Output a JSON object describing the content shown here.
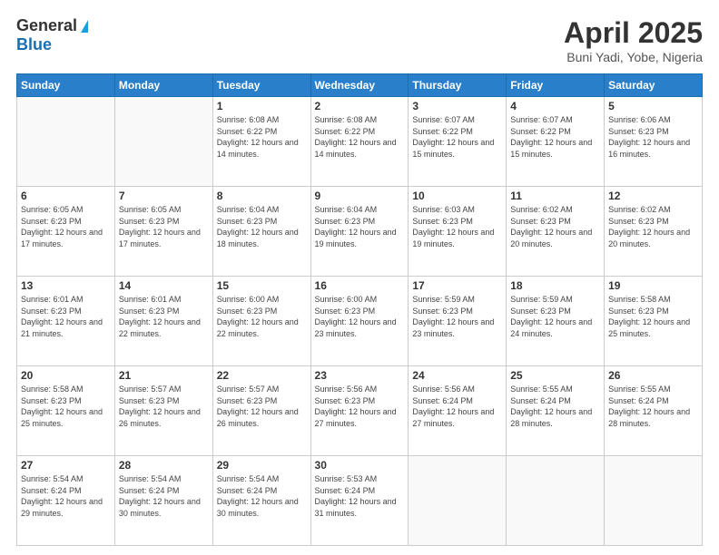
{
  "logo": {
    "general": "General",
    "blue": "Blue"
  },
  "title": "April 2025",
  "location": "Buni Yadi, Yobe, Nigeria",
  "days_of_week": [
    "Sunday",
    "Monday",
    "Tuesday",
    "Wednesday",
    "Thursday",
    "Friday",
    "Saturday"
  ],
  "weeks": [
    [
      {
        "num": "",
        "info": ""
      },
      {
        "num": "",
        "info": ""
      },
      {
        "num": "1",
        "info": "Sunrise: 6:08 AM\nSunset: 6:22 PM\nDaylight: 12 hours and 14 minutes."
      },
      {
        "num": "2",
        "info": "Sunrise: 6:08 AM\nSunset: 6:22 PM\nDaylight: 12 hours and 14 minutes."
      },
      {
        "num": "3",
        "info": "Sunrise: 6:07 AM\nSunset: 6:22 PM\nDaylight: 12 hours and 15 minutes."
      },
      {
        "num": "4",
        "info": "Sunrise: 6:07 AM\nSunset: 6:22 PM\nDaylight: 12 hours and 15 minutes."
      },
      {
        "num": "5",
        "info": "Sunrise: 6:06 AM\nSunset: 6:23 PM\nDaylight: 12 hours and 16 minutes."
      }
    ],
    [
      {
        "num": "6",
        "info": "Sunrise: 6:05 AM\nSunset: 6:23 PM\nDaylight: 12 hours and 17 minutes."
      },
      {
        "num": "7",
        "info": "Sunrise: 6:05 AM\nSunset: 6:23 PM\nDaylight: 12 hours and 17 minutes."
      },
      {
        "num": "8",
        "info": "Sunrise: 6:04 AM\nSunset: 6:23 PM\nDaylight: 12 hours and 18 minutes."
      },
      {
        "num": "9",
        "info": "Sunrise: 6:04 AM\nSunset: 6:23 PM\nDaylight: 12 hours and 19 minutes."
      },
      {
        "num": "10",
        "info": "Sunrise: 6:03 AM\nSunset: 6:23 PM\nDaylight: 12 hours and 19 minutes."
      },
      {
        "num": "11",
        "info": "Sunrise: 6:02 AM\nSunset: 6:23 PM\nDaylight: 12 hours and 20 minutes."
      },
      {
        "num": "12",
        "info": "Sunrise: 6:02 AM\nSunset: 6:23 PM\nDaylight: 12 hours and 20 minutes."
      }
    ],
    [
      {
        "num": "13",
        "info": "Sunrise: 6:01 AM\nSunset: 6:23 PM\nDaylight: 12 hours and 21 minutes."
      },
      {
        "num": "14",
        "info": "Sunrise: 6:01 AM\nSunset: 6:23 PM\nDaylight: 12 hours and 22 minutes."
      },
      {
        "num": "15",
        "info": "Sunrise: 6:00 AM\nSunset: 6:23 PM\nDaylight: 12 hours and 22 minutes."
      },
      {
        "num": "16",
        "info": "Sunrise: 6:00 AM\nSunset: 6:23 PM\nDaylight: 12 hours and 23 minutes."
      },
      {
        "num": "17",
        "info": "Sunrise: 5:59 AM\nSunset: 6:23 PM\nDaylight: 12 hours and 23 minutes."
      },
      {
        "num": "18",
        "info": "Sunrise: 5:59 AM\nSunset: 6:23 PM\nDaylight: 12 hours and 24 minutes."
      },
      {
        "num": "19",
        "info": "Sunrise: 5:58 AM\nSunset: 6:23 PM\nDaylight: 12 hours and 25 minutes."
      }
    ],
    [
      {
        "num": "20",
        "info": "Sunrise: 5:58 AM\nSunset: 6:23 PM\nDaylight: 12 hours and 25 minutes."
      },
      {
        "num": "21",
        "info": "Sunrise: 5:57 AM\nSunset: 6:23 PM\nDaylight: 12 hours and 26 minutes."
      },
      {
        "num": "22",
        "info": "Sunrise: 5:57 AM\nSunset: 6:23 PM\nDaylight: 12 hours and 26 minutes."
      },
      {
        "num": "23",
        "info": "Sunrise: 5:56 AM\nSunset: 6:23 PM\nDaylight: 12 hours and 27 minutes."
      },
      {
        "num": "24",
        "info": "Sunrise: 5:56 AM\nSunset: 6:24 PM\nDaylight: 12 hours and 27 minutes."
      },
      {
        "num": "25",
        "info": "Sunrise: 5:55 AM\nSunset: 6:24 PM\nDaylight: 12 hours and 28 minutes."
      },
      {
        "num": "26",
        "info": "Sunrise: 5:55 AM\nSunset: 6:24 PM\nDaylight: 12 hours and 28 minutes."
      }
    ],
    [
      {
        "num": "27",
        "info": "Sunrise: 5:54 AM\nSunset: 6:24 PM\nDaylight: 12 hours and 29 minutes."
      },
      {
        "num": "28",
        "info": "Sunrise: 5:54 AM\nSunset: 6:24 PM\nDaylight: 12 hours and 30 minutes."
      },
      {
        "num": "29",
        "info": "Sunrise: 5:54 AM\nSunset: 6:24 PM\nDaylight: 12 hours and 30 minutes."
      },
      {
        "num": "30",
        "info": "Sunrise: 5:53 AM\nSunset: 6:24 PM\nDaylight: 12 hours and 31 minutes."
      },
      {
        "num": "",
        "info": ""
      },
      {
        "num": "",
        "info": ""
      },
      {
        "num": "",
        "info": ""
      }
    ]
  ]
}
